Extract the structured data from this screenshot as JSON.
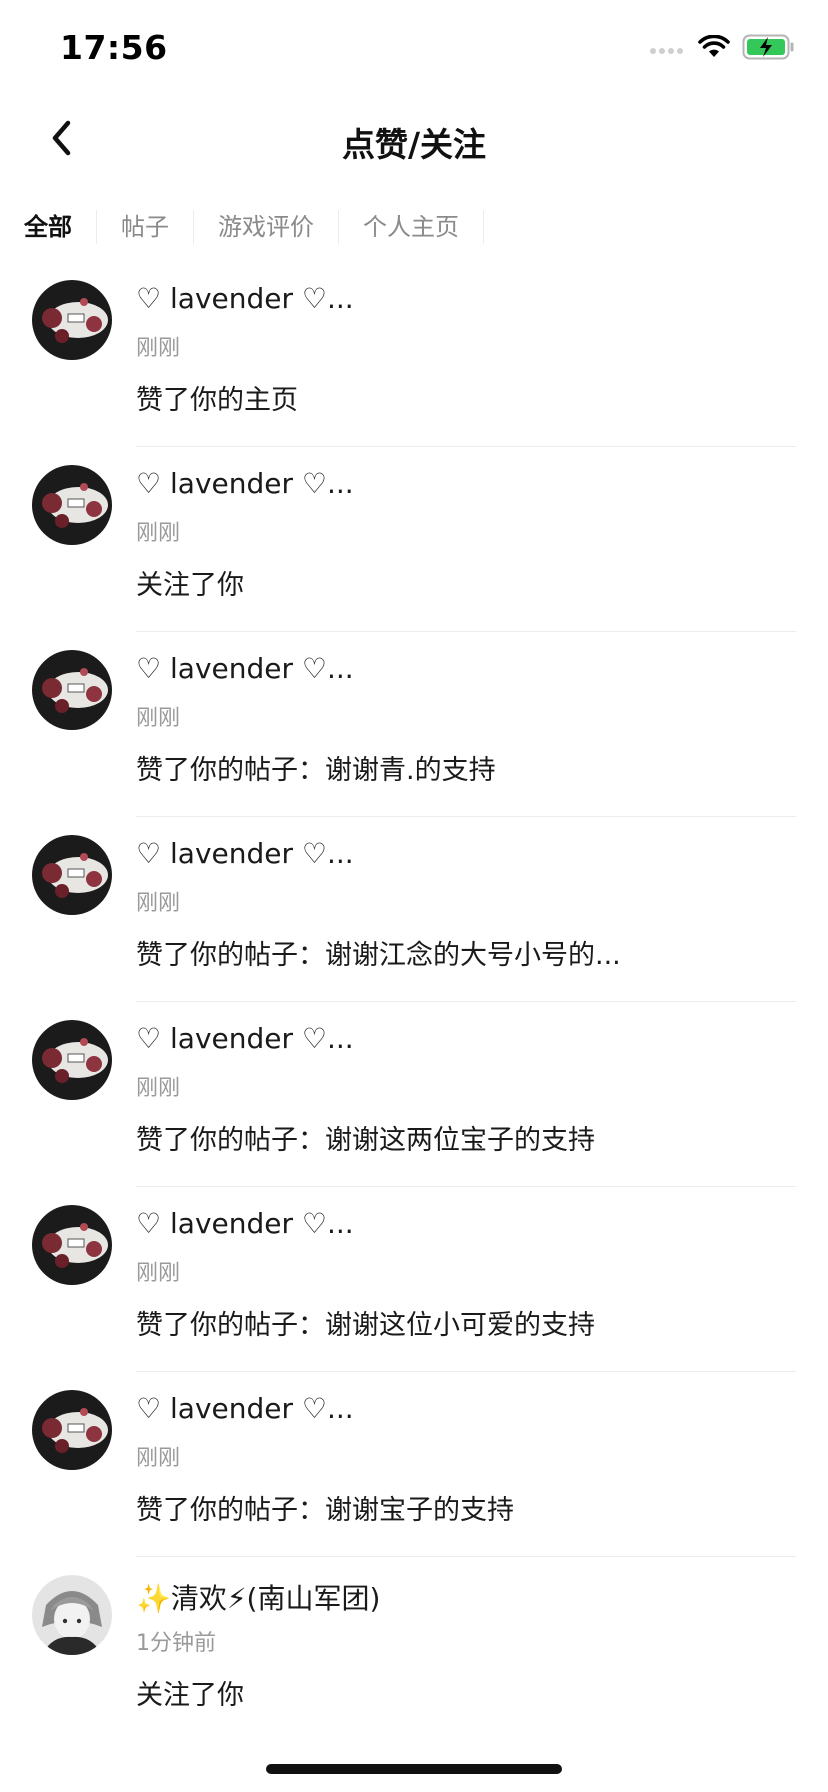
{
  "status_bar": {
    "time": "17:56",
    "icons": [
      "signal-dots-icon",
      "wifi-icon",
      "battery-charging-icon"
    ],
    "battery_color": "#34c759"
  },
  "nav": {
    "back_icon": "chevron-left-icon",
    "title": "点赞/关注"
  },
  "tabs": [
    {
      "label": "全部",
      "active": true
    },
    {
      "label": "帖子",
      "active": false
    },
    {
      "label": "游戏评价",
      "active": false
    },
    {
      "label": "个人主页",
      "active": false
    }
  ],
  "items": [
    {
      "name": "♡ lavender ♡...",
      "time": "刚刚",
      "text": "赞了你的主页",
      "avatar": "rose-avatar"
    },
    {
      "name": "♡ lavender ♡...",
      "time": "刚刚",
      "text": "关注了你",
      "avatar": "rose-avatar"
    },
    {
      "name": "♡ lavender ♡...",
      "time": "刚刚",
      "text": "赞了你的帖子：谢谢青.的支持",
      "avatar": "rose-avatar"
    },
    {
      "name": "♡ lavender ♡...",
      "time": "刚刚",
      "text": "赞了你的帖子：谢谢江念的大号小号的...",
      "avatar": "rose-avatar"
    },
    {
      "name": "♡ lavender ♡...",
      "time": "刚刚",
      "text": "赞了你的帖子：谢谢这两位宝子的支持",
      "avatar": "rose-avatar"
    },
    {
      "name": "♡ lavender ♡...",
      "time": "刚刚",
      "text": "赞了你的帖子：谢谢这位小可爱的支持",
      "avatar": "rose-avatar"
    },
    {
      "name": "♡ lavender ♡...",
      "time": "刚刚",
      "text": "赞了你的帖子：谢谢宝子的支持",
      "avatar": "rose-avatar"
    },
    {
      "name": "✨清欢⚡(南山军团)",
      "time": "1分钟前",
      "text": "关注了你",
      "avatar": "anime-avatar"
    }
  ]
}
